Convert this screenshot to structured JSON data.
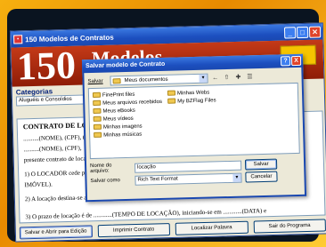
{
  "main": {
    "title": "150 Modelos de Contratos",
    "banner_number": "150",
    "banner_word": "Modelos",
    "categories_label": "Categorias",
    "category_selected": "Aluguéis e Consoídios",
    "doc_heading": "CONTRATO DE LOCAÇÃ",
    "doc_lines": [
      "..........(NOME), (CPF), (",
      "..........(NOME), (CPF),",
      "presente contrato de loca"
    ],
    "clause1": "1) O LOCADOR cede par",
    "clause1b": "IMÓVEL).",
    "clause2": "2) A locação destina-se a",
    "clause3": "3) O prazo de locação é de ............(TEMPO DE LOCAÇÃO), iniciando-se em ............(DATA) e",
    "right_text": "DO",
    "buttons": [
      "Salvar e Abrir para Edição",
      "Imprimir Contrato",
      "Localizar Palavra",
      "Sair do Programa"
    ]
  },
  "dialog": {
    "title": "Salvar modelo de Contrato",
    "save_in_label": "Salvar",
    "save_in_value": "Meus documentos",
    "folders_col1": [
      "FinePrint files",
      "Meus arquivos recebidos",
      "Meus eBooks",
      "Meus vídeos",
      "Minhas imagens",
      "Minhas músicas"
    ],
    "folders_col2": [
      "Minhas Webs",
      "My BZFlag Files"
    ],
    "filename_label": "Nome do arquivo:",
    "filename_value": "locação",
    "filetype_label": "Salvar como",
    "filetype_value": "Rich Text Format",
    "save_button": "Salvar",
    "cancel_button": "Cancelar",
    "help_button": "?",
    "close_button": "X"
  }
}
